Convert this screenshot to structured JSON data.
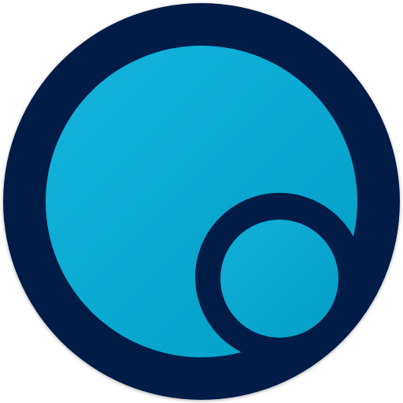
{
  "icon": {
    "name": "circle-logo-icon",
    "colors": {
      "outer_ring": "#031e46",
      "large_circle_light": "#14b4dc",
      "large_circle_dark": "#029fc6",
      "small_circle_light": "#13b0d8",
      "small_circle_dark": "#039ec5",
      "background": "#ffffff"
    }
  }
}
